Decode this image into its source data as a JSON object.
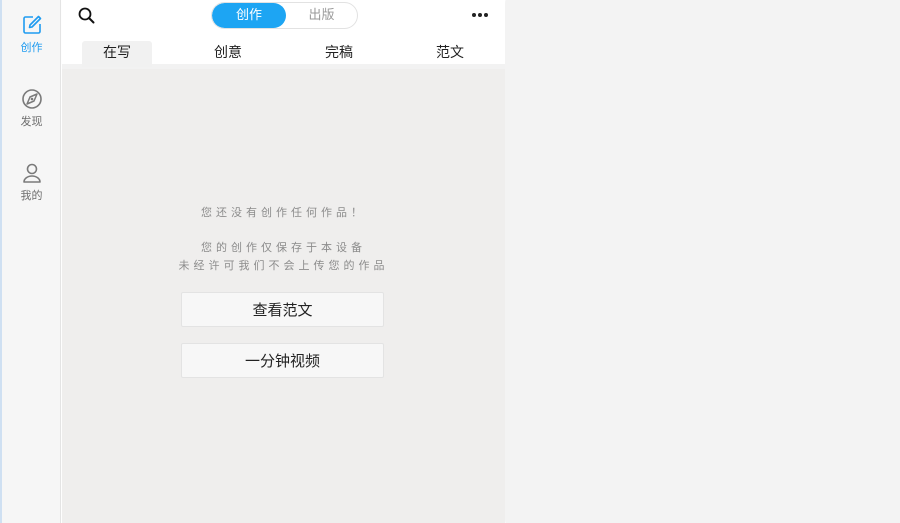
{
  "sidebar": {
    "items": [
      {
        "label": "创作",
        "icon": "edit-icon",
        "active": true
      },
      {
        "label": "发现",
        "icon": "discover-icon",
        "active": false
      },
      {
        "label": "我的",
        "icon": "user-icon",
        "active": false
      }
    ]
  },
  "header": {
    "search_icon": "search-icon",
    "segments": [
      "创作",
      "出版"
    ],
    "active_segment": "创作",
    "more_icon": "more-icon"
  },
  "tabs": [
    "在写",
    "创意",
    "完稿",
    "范文"
  ],
  "active_tab": "在写",
  "empty_state": {
    "line1": "您还没有创作任何作品！",
    "line2": "您的创作仅保存于本设备",
    "line3": "未经许可我们不会上传您的作品"
  },
  "buttons": {
    "view_samples": "查看范文",
    "one_minute_video": "一分钟视频"
  },
  "colors": {
    "accent": "#1da5f3",
    "panel_bg": "#efeeed",
    "sidebar_bg": "#f6f6f6"
  }
}
